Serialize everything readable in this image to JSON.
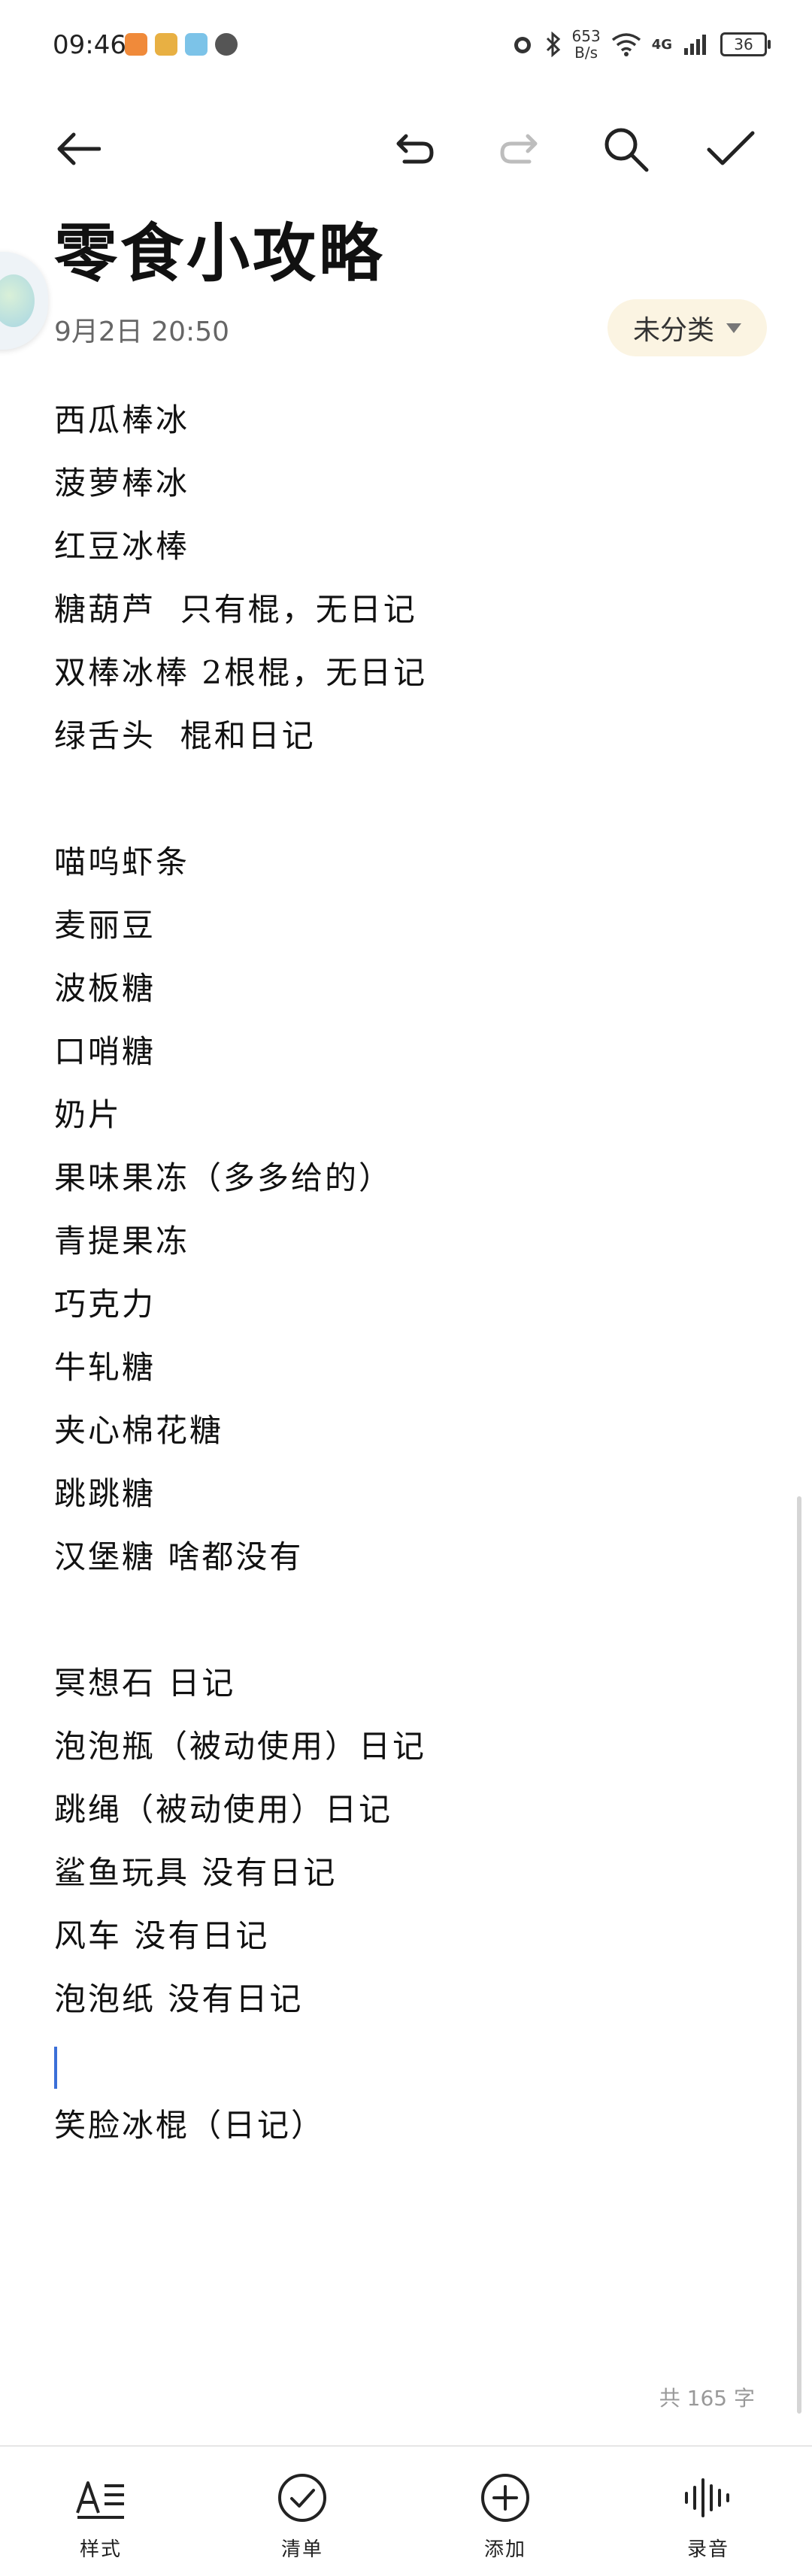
{
  "status_bar": {
    "time": "09:46",
    "speed_value": "653",
    "speed_unit": "B/s",
    "network": "4G",
    "battery": "36",
    "app_icon_colors": [
      "#f08a3a",
      "#e8b043",
      "#7cc3e8",
      "#555555"
    ]
  },
  "toolbar": {
    "back_icon": "arrow-left",
    "undo_icon": "undo",
    "redo_icon": "redo",
    "search_icon": "search",
    "done_icon": "check"
  },
  "note": {
    "title": "零食小攻略",
    "date": "9月2日  20:50",
    "category": "未分类",
    "lines": [
      "西瓜棒冰",
      "菠萝棒冰",
      "红豆冰棒",
      "糖葫芦  只有棍，无日记",
      "双棒冰棒 2根棍，无日记",
      "绿舌头  棍和日记",
      "",
      "喵呜虾条",
      "麦丽豆",
      "波板糖",
      "口哨糖",
      "奶片",
      "果味果冻（多多给的）",
      "青提果冻",
      "巧克力",
      "牛轧糖",
      "夹心棉花糖",
      "跳跳糖",
      "汉堡糖 啥都没有",
      "",
      "冥想石 日记",
      "泡泡瓶（被动使用）日记",
      "跳绳（被动使用）日记",
      "鲨鱼玩具 没有日记",
      "风车 没有日记",
      "泡泡纸 没有日记",
      "",
      "笑脸冰棍（日记）"
    ],
    "caret_line_index": 26,
    "word_count": "共 165 字"
  },
  "bottom_bar": {
    "items": [
      {
        "label": "样式",
        "icon": "text-style-icon"
      },
      {
        "label": "清单",
        "icon": "checklist-icon"
      },
      {
        "label": "添加",
        "icon": "add-circle-icon"
      },
      {
        "label": "录音",
        "icon": "voice-wave-icon"
      }
    ]
  },
  "colors": {
    "accent_caret": "#3b6fd8",
    "chip_bg": "#fbf4e2"
  }
}
